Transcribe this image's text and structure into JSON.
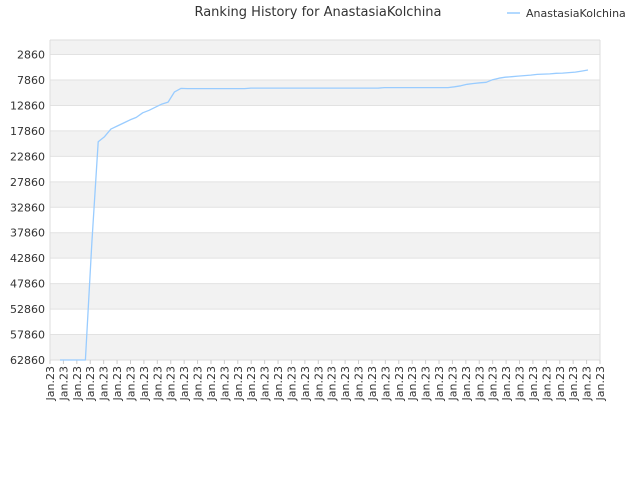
{
  "chart_data": {
    "type": "line",
    "title": "Ranking History for AnastasiaKolchina",
    "xlabel": "",
    "ylabel": "",
    "y_inverted": true,
    "ylim": [
      62860,
      0
    ],
    "y_ticks": [
      2860,
      7860,
      12860,
      17860,
      22860,
      27860,
      32860,
      37860,
      42860,
      47860,
      52860,
      57860,
      62860
    ],
    "x_tick_labels": [
      "Jan.23",
      "Jan.23",
      "Jan.23",
      "Jan.23",
      "Jan.23",
      "Jan.23",
      "Jan.23",
      "Jan.23",
      "Jan.23",
      "Jan.23",
      "Jan.23",
      "Jan.23",
      "Jan.23",
      "Jan.23",
      "Jan.23",
      "Jan.23",
      "Jan.23",
      "Jan.23",
      "Jan.23",
      "Jan.23",
      "Jan.23",
      "Jan.23",
      "Jan.23",
      "Jan.23",
      "Jan.23",
      "Jan.23",
      "Jan.23",
      "Jan.23",
      "Jan.23",
      "Jan.23",
      "Jan.23",
      "Jan.23",
      "Jan.23",
      "Jan.23",
      "Jan.23",
      "Jan.23",
      "Jan.23",
      "Jan.23",
      "Jan.23",
      "Jan.23",
      "Jan.23",
      "Jan.23"
    ],
    "grid": true,
    "legend_position": "top-right",
    "series": [
      {
        "name": "AnastasiaKolchina",
        "color": "#99ccff",
        "points": [
          [
            0,
            62860
          ],
          [
            1,
            62860
          ],
          [
            2,
            62860
          ],
          [
            3,
            62860
          ],
          [
            4,
            62860
          ],
          [
            5,
            40000
          ],
          [
            6,
            20000
          ],
          [
            7,
            19000
          ],
          [
            8,
            17500
          ],
          [
            9,
            16900
          ],
          [
            10,
            16300
          ],
          [
            11,
            15700
          ],
          [
            12,
            15200
          ],
          [
            13,
            14300
          ],
          [
            14,
            13800
          ],
          [
            15,
            13200
          ],
          [
            16,
            12600
          ],
          [
            17,
            12200
          ],
          [
            18,
            10200
          ],
          [
            19,
            9500
          ],
          [
            20,
            9550
          ],
          [
            21,
            9550
          ],
          [
            22,
            9550
          ],
          [
            23,
            9550
          ],
          [
            24,
            9550
          ],
          [
            25,
            9550
          ],
          [
            26,
            9550
          ],
          [
            27,
            9550
          ],
          [
            28,
            9550
          ],
          [
            29,
            9550
          ],
          [
            30,
            9450
          ],
          [
            31,
            9450
          ],
          [
            32,
            9450
          ],
          [
            33,
            9450
          ],
          [
            34,
            9450
          ],
          [
            35,
            9450
          ],
          [
            36,
            9450
          ],
          [
            37,
            9450
          ],
          [
            38,
            9450
          ],
          [
            39,
            9450
          ],
          [
            40,
            9450
          ],
          [
            41,
            9450
          ],
          [
            42,
            9450
          ],
          [
            43,
            9450
          ],
          [
            44,
            9450
          ],
          [
            45,
            9450
          ],
          [
            46,
            9450
          ],
          [
            47,
            9450
          ],
          [
            48,
            9450
          ],
          [
            49,
            9450
          ],
          [
            50,
            9450
          ],
          [
            51,
            9350
          ],
          [
            52,
            9350
          ],
          [
            53,
            9350
          ],
          [
            54,
            9350
          ],
          [
            55,
            9350
          ],
          [
            56,
            9350
          ],
          [
            57,
            9350
          ],
          [
            58,
            9350
          ],
          [
            59,
            9350
          ],
          [
            60,
            9350
          ],
          [
            61,
            9350
          ],
          [
            62,
            9200
          ],
          [
            63,
            9000
          ],
          [
            64,
            8700
          ],
          [
            65,
            8550
          ],
          [
            66,
            8400
          ],
          [
            67,
            8300
          ],
          [
            68,
            7800
          ],
          [
            69,
            7500
          ],
          [
            70,
            7300
          ],
          [
            71,
            7200
          ],
          [
            72,
            7100
          ],
          [
            73,
            7000
          ],
          [
            74,
            6900
          ],
          [
            75,
            6750
          ],
          [
            76,
            6700
          ],
          [
            77,
            6650
          ],
          [
            78,
            6550
          ],
          [
            79,
            6500
          ],
          [
            80,
            6400
          ],
          [
            81,
            6300
          ],
          [
            82,
            6100
          ],
          [
            83,
            5900
          ]
        ]
      }
    ],
    "x_domain": [
      0,
      83
    ]
  }
}
